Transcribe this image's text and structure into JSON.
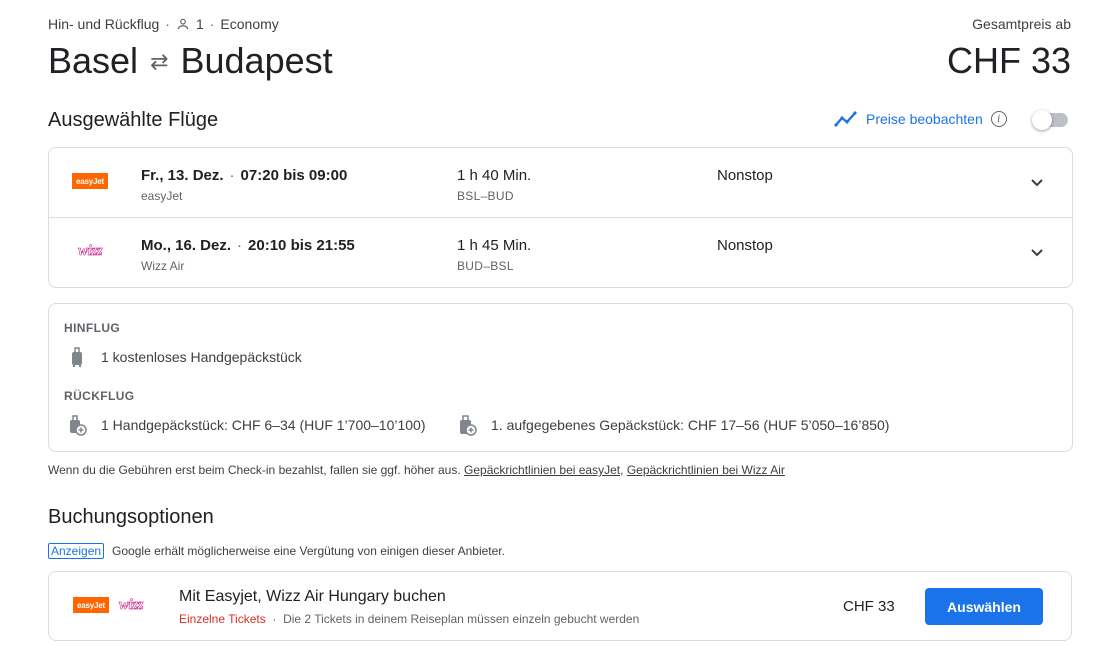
{
  "header": {
    "trip_type": "Hin- und Rückflug",
    "passengers": "1",
    "cabin": "Economy",
    "origin": "Basel",
    "destination": "Budapest",
    "total_label": "Gesamtpreis ab",
    "total_price": "CHF 33"
  },
  "selected": {
    "title": "Ausgewählte Flüge",
    "watch_label": "Preise beobachten",
    "watch_enabled": false
  },
  "flights": [
    {
      "airline_logo": "easyJet",
      "date": "Fr., 13. Dez.",
      "times": "07:20 bis 09:00",
      "airline": "easyJet",
      "duration": "1 h 40 Min.",
      "route": "BSL–BUD",
      "stops": "Nonstop"
    },
    {
      "airline_logo": "wizz",
      "date": "Mo., 16. Dez.",
      "times": "20:10 bis 21:55",
      "airline": "Wizz Air",
      "duration": "1 h 45 Min.",
      "route": "BUD–BSL",
      "stops": "Nonstop"
    }
  ],
  "baggage": {
    "outbound_heading": "HINFLUG",
    "outbound_item": "1 kostenloses Handgepäckstück",
    "return_heading": "RÜCKFLUG",
    "return_item_1": "1 Handgepäckstück: CHF 6–34 (HUF 1’700–10’100)",
    "return_item_2": "1. aufgegebenes Gepäckstück: CHF 17–56 (HUF 5’050–16’850)"
  },
  "fee_note": {
    "text": "Wenn du die Gebühren erst beim Check-in bezahlst, fallen sie ggf. höher aus.",
    "link_easyjet": "Gepäckrichtlinien bei easyJet",
    "separator": ",",
    "link_wizz": "Gepäckrichtlinien bei Wizz Air"
  },
  "booking": {
    "title": "Buchungsoptionen",
    "ad_badge": "Anzeigen",
    "ad_text": "Google erhält möglicherweise eine Vergütung von einigen dieser Anbieter.",
    "option_title": "Mit Easyjet, Wizz Air Hungary buchen",
    "option_warning": "Einzelne Tickets",
    "option_note": "Die 2 Tickets in deinem Reiseplan müssen einzeln gebucht werden",
    "option_price": "CHF 33",
    "select_label": "Auswählen"
  },
  "colors": {
    "accent": "#1a73e8",
    "warning": "#d93025",
    "easyjet": "#ff6600",
    "wizz": "#c6007e"
  }
}
